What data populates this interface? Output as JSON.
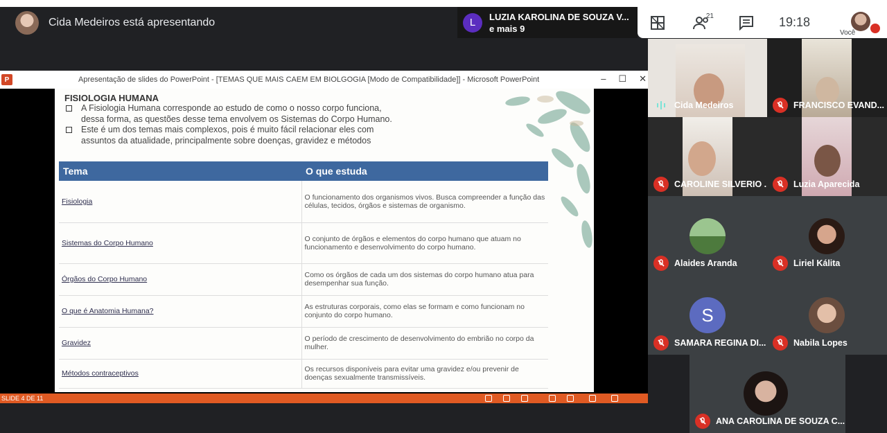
{
  "presenter": {
    "text": "Cida Medeiros está apresentando"
  },
  "notification": {
    "avatar_letter": "L",
    "name": "LUZIA KAROLINA DE SOUZA V...",
    "extra": "e mais 9"
  },
  "controls": {
    "participants_count": "21",
    "time": "19:18",
    "you_label": "Você"
  },
  "ppt": {
    "window_title": "Apresentação de slides do PowerPoint - [TEMAS QUE MAIS CAEM EM BIOLGOGIA [Modo de Compatibilidade]] - Microsoft PowerPoint",
    "status_text": "SLIDE 4 DE 11",
    "slide": {
      "heading": "FISIOLOGIA HUMANA",
      "bullets": [
        "A Fisiologia Humana corresponde ao estudo de como o nosso corpo funciona, dessa forma, as questões desse tema envolvem os Sistemas do Corpo Humano.",
        "Este é um dos temas mais complexos, pois é muito fácil relacionar eles com assuntos da atualidade, principalmente sobre doenças, gravidez e métodos"
      ],
      "table": {
        "headers": [
          "Tema",
          "O que estuda"
        ],
        "rows": [
          [
            "Fisiologia",
            "O funcionamento dos organismos vivos. Busca compreender a função das células, tecidos, órgãos e sistemas de organismo."
          ],
          [
            "Sistemas do Corpo Humano",
            "O conjunto de órgãos e elementos do corpo humano que atuam no funcionamento e desenvolvimento do corpo humano."
          ],
          [
            "Órgãos do Corpo Humano",
            "Como os órgãos de cada um dos sistemas do corpo humano atua para desempenhar sua função."
          ],
          [
            "O que é Anatomia Humana?",
            "As estruturas corporais, como elas se formam e como funcionam no conjunto do corpo humano."
          ],
          [
            "Gravidez",
            "O período de crescimento de desenvolvimento do embrião no corpo da mulher."
          ],
          [
            "Métodos contraceptivos",
            "Os recursos disponíveis para evitar uma gravidez e/ou prevenir de doenças sexualmente transmissíveis."
          ]
        ]
      }
    }
  },
  "participants": [
    {
      "name": "Cida Medeiros",
      "mic": "on"
    },
    {
      "name": "FRANCISCO EVAND...",
      "mic": "off"
    },
    {
      "name": "CAROLINE SILVERIO ...",
      "mic": "off"
    },
    {
      "name": "Luzia Aparecida",
      "mic": "off"
    },
    {
      "name": "Alaides Aranda",
      "mic": "off"
    },
    {
      "name": "Liriel Kálita",
      "mic": "off"
    },
    {
      "name": "SAMARA REGINA DI...",
      "mic": "off",
      "avatar_letter": "S",
      "avatar_color": "#5c6bc0"
    },
    {
      "name": "Nabila Lopes",
      "mic": "off"
    },
    {
      "name": "ANA CAROLINA DE SOUZA C...",
      "mic": "off"
    }
  ]
}
